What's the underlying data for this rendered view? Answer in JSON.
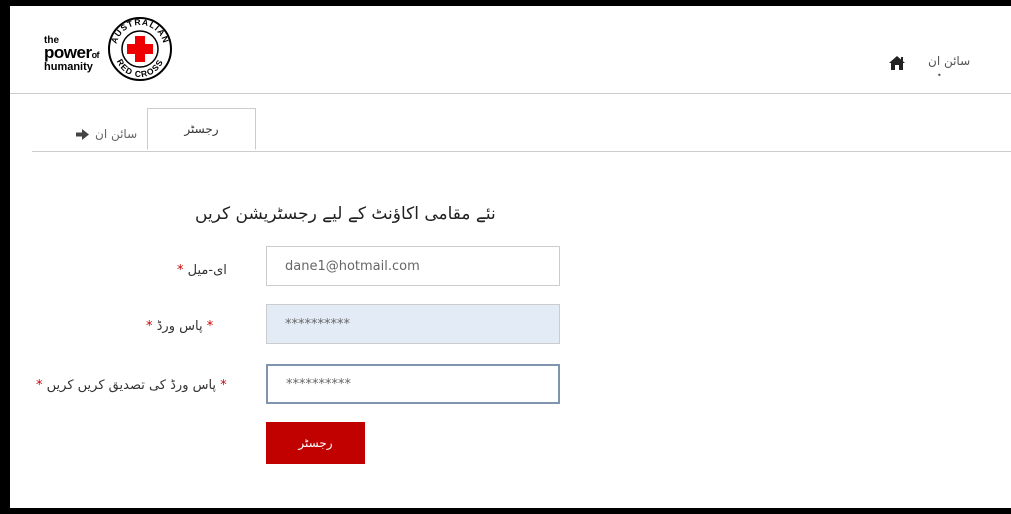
{
  "header": {
    "logo": {
      "line1": "the",
      "line2_main": "power",
      "line2_small": "of",
      "line3": "humanity",
      "seal_top": "AUSTRALIAN",
      "seal_bottom": "RED CROSS"
    },
    "home_icon": "home-icon",
    "sign_in_link": "سائن ان",
    "sign_in_dot": "•"
  },
  "tabs": {
    "sign_in": "سائن ان",
    "sign_in_icon": "arrow-right-icon",
    "register": "رجسٹر"
  },
  "form": {
    "title": "نئے مقامی اکاؤنٹ کے لیے رجسٹریشن کریں",
    "required_mark": "*",
    "email_label": "ای-میل",
    "email_value": "dane1@hotmail.com",
    "password_label": "پاس ورڈ",
    "password_value": "**********",
    "confirm_label": "پاس ورڈ کی تصدیق کریں کریں",
    "confirm_value": "**********",
    "submit_label": "رجسٹر"
  },
  "colors": {
    "brand_red": "#c10000",
    "required": "#cc0000",
    "autofill_bg": "#e3ecf6"
  }
}
